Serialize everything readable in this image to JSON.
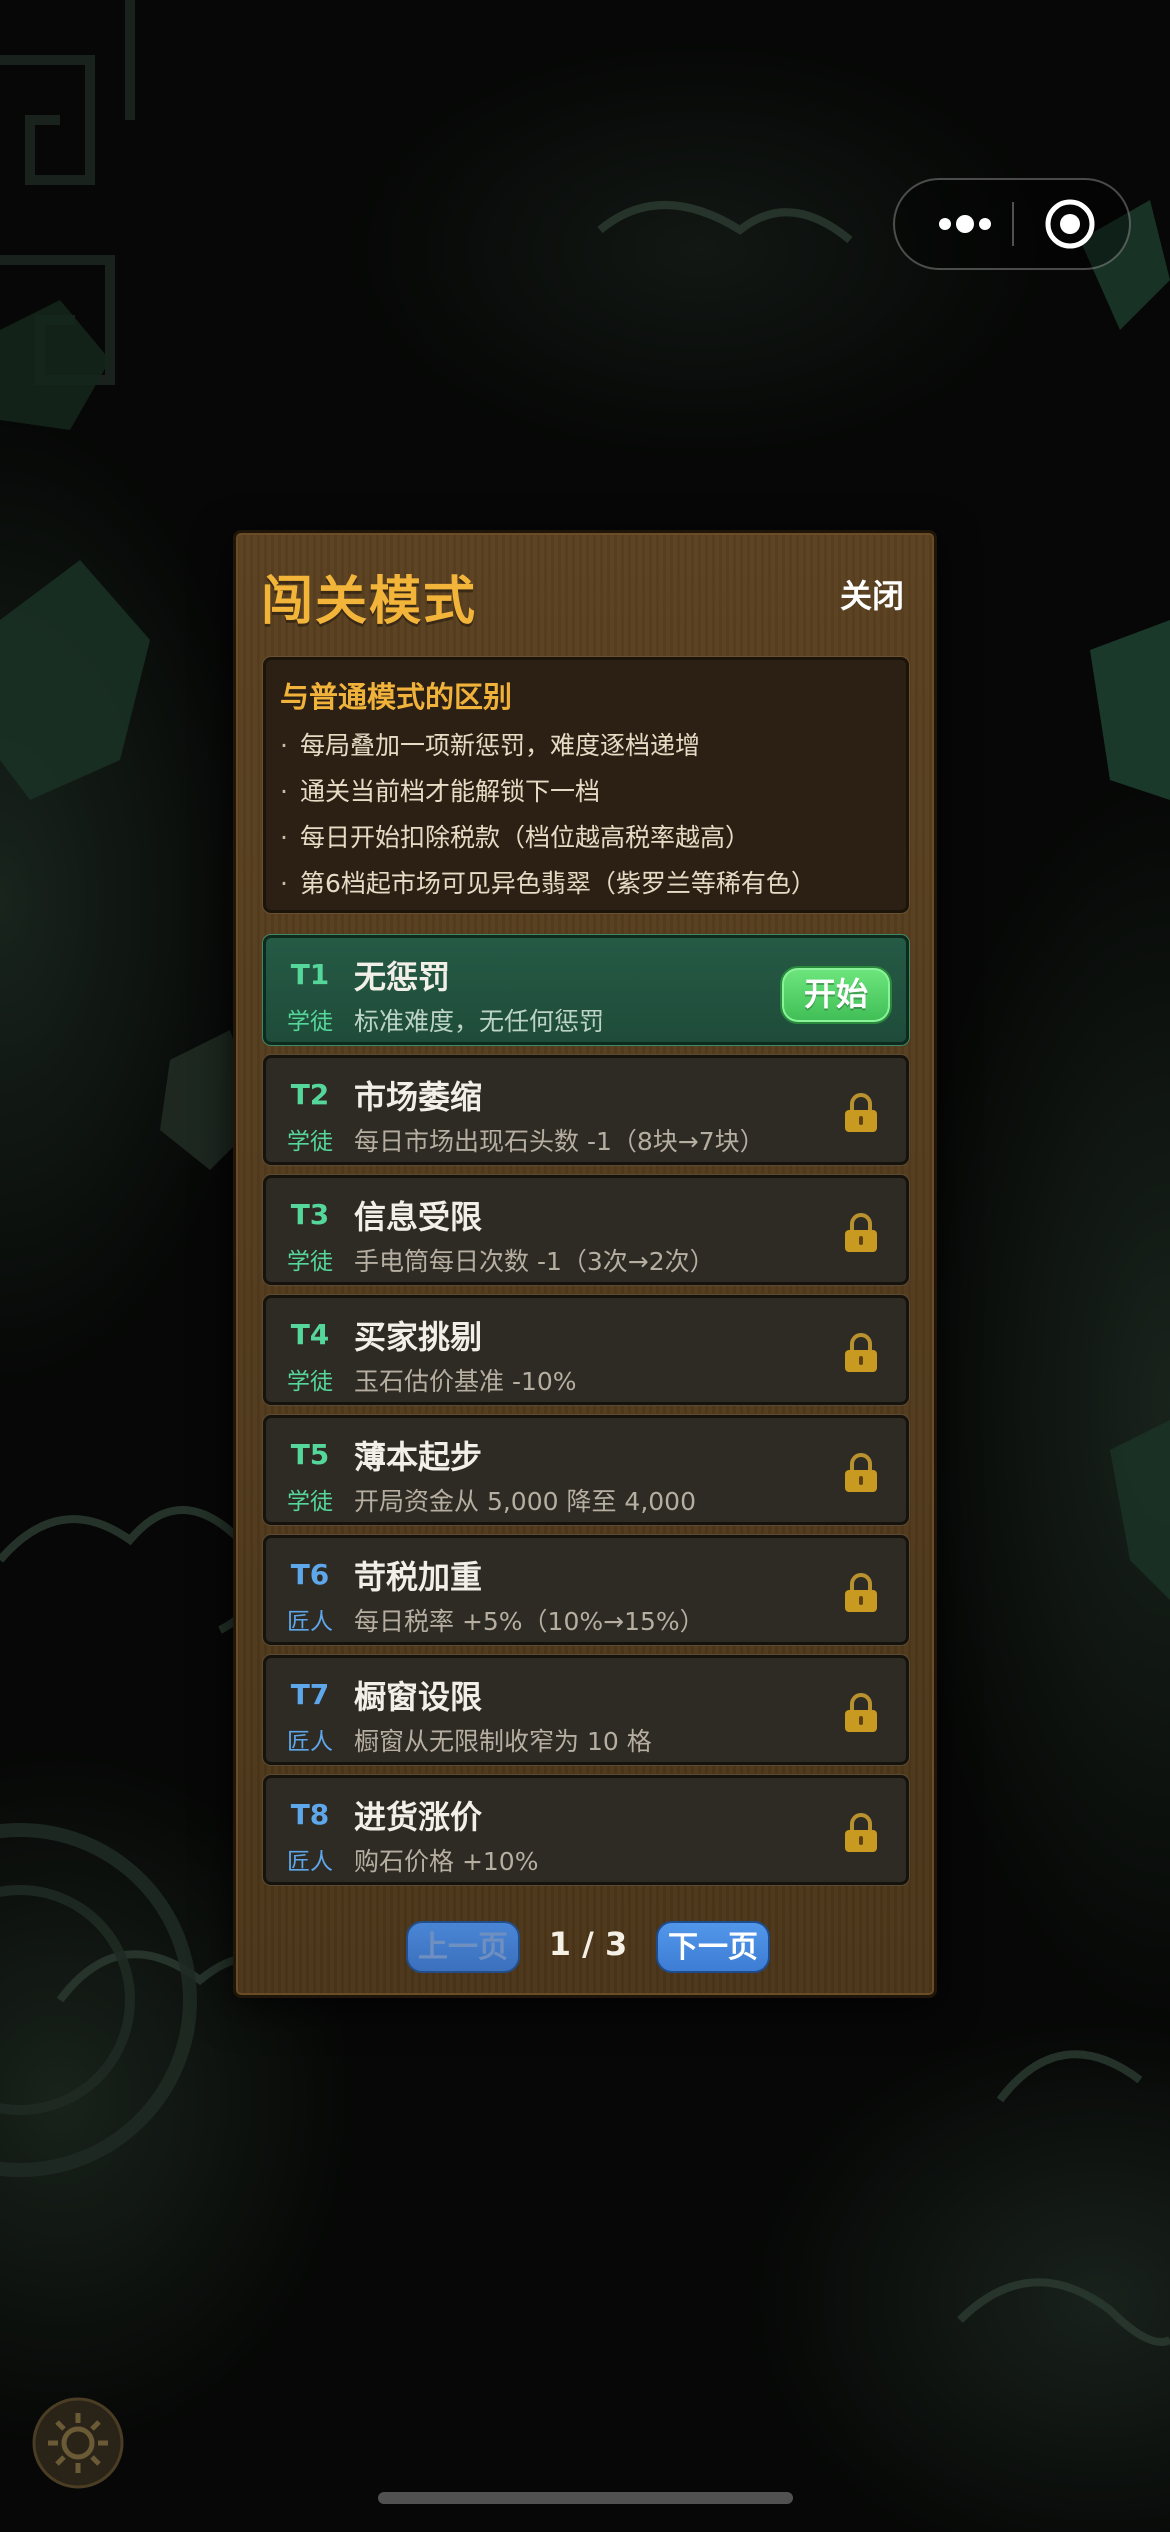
{
  "dialog": {
    "title": "闯关模式",
    "close_label": "关闭"
  },
  "rules": {
    "heading": "与普通模式的区别",
    "bullet": "·",
    "lines": [
      "每局叠加一项新惩罚，难度逐档递增",
      "通关当前档才能解锁下一档",
      "每日开始扣除税款（档位越高税率越高）",
      "第6档起市场可见异色翡翠（紫罗兰等稀有色）"
    ]
  },
  "levels": [
    {
      "tier": "T1",
      "rank": "学徒",
      "name": "无惩罚",
      "desc": "标准难度，无任何惩罚",
      "status": "unlocked",
      "action_label": "开始"
    },
    {
      "tier": "T2",
      "rank": "学徒",
      "name": "市场萎缩",
      "desc": "每日市场出现石头数 -1（8块→7块）",
      "status": "locked"
    },
    {
      "tier": "T3",
      "rank": "学徒",
      "name": "信息受限",
      "desc": "手电筒每日次数 -1（3次→2次）",
      "status": "locked"
    },
    {
      "tier": "T4",
      "rank": "学徒",
      "name": "买家挑剔",
      "desc": "玉石估价基准 -10%",
      "status": "locked"
    },
    {
      "tier": "T5",
      "rank": "学徒",
      "name": "薄本起步",
      "desc": "开局资金从 5,000 降至 4,000",
      "status": "locked"
    },
    {
      "tier": "T6",
      "rank": "匠人",
      "name": "苛税加重",
      "desc": "每日税率 +5%（10%→15%）",
      "status": "locked"
    },
    {
      "tier": "T7",
      "rank": "匠人",
      "name": "橱窗设限",
      "desc": "橱窗从无限制收窄为 10 格",
      "status": "locked"
    },
    {
      "tier": "T8",
      "rank": "匠人",
      "name": "进货涨价",
      "desc": "购石价格 +10%",
      "status": "locked"
    }
  ],
  "pager": {
    "prev_label": "上一页",
    "next_label": "下一页",
    "current_page": 1,
    "total_pages": 3,
    "indicator": "1 / 3"
  },
  "colors": {
    "title": "#f3b43a",
    "apprentice": "#55d69a",
    "artisan": "#5ea7ea",
    "start_button": "#4fcf64",
    "pager_button": "#4a86d6"
  },
  "icons": [
    "more-dots-icon",
    "target-icon",
    "lock-icon",
    "gear-icon"
  ]
}
